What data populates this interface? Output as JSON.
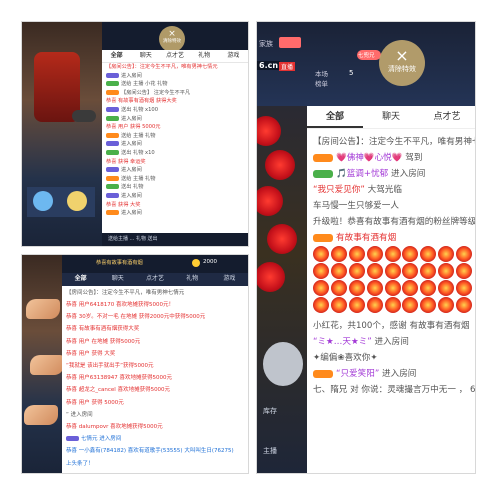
{
  "top_left": {
    "close_label": "清除特效",
    "tabs": [
      "全部",
      "聊天",
      "点才艺",
      "礼物",
      "游戏"
    ],
    "announcement": "【房间公告】：注定今生不平凡，唯有男神七情元",
    "lines": [
      {
        "name": "",
        "text": "进入房间",
        "tag": ""
      },
      {
        "name": "",
        "text": "送给 主播 小花 礼物",
        "tag": ""
      },
      {
        "name": "",
        "text": "【房间公告】 注定今生不平凡",
        "tag": ""
      },
      {
        "name": "",
        "text": "恭喜 有故事有酒有烟 获得大奖",
        "tag": ""
      },
      {
        "name": "",
        "text": "送出 礼物 x100",
        "tag": ""
      },
      {
        "name": "",
        "text": "进入房间",
        "tag": ""
      },
      {
        "name": "",
        "text": "恭喜 用户 获得 5000元",
        "tag": ""
      },
      {
        "name": "",
        "text": "送给 主播 礼物",
        "tag": ""
      },
      {
        "name": "",
        "text": "进入房间",
        "tag": ""
      },
      {
        "name": "",
        "text": "送出 礼物 x10",
        "tag": ""
      },
      {
        "name": "",
        "text": "恭喜 获得 幸运奖",
        "tag": ""
      },
      {
        "name": "",
        "text": "进入房间",
        "tag": ""
      },
      {
        "name": "",
        "text": "送给 主播 礼物",
        "tag": ""
      },
      {
        "name": "",
        "text": "送出 礼物",
        "tag": ""
      },
      {
        "name": "",
        "text": "进入房间",
        "tag": ""
      },
      {
        "name": "",
        "text": "恭喜 获得 大奖",
        "tag": ""
      },
      {
        "name": "",
        "text": "进入房间",
        "tag": ""
      }
    ],
    "bottom_bar": "送给主播 ... 礼物 送出"
  },
  "bottom_left": {
    "tabs": [
      "全部",
      "聊天",
      "点才艺",
      "礼物",
      "游戏"
    ],
    "gift_count": "2000",
    "header_text": "恭喜有故事有酒有烟",
    "announcement": "【房间公告】：注定今生不平凡，唯有男神七情元",
    "lines": [
      {
        "text": "恭喜 用户6418170 喜欢地摊获得5000元！"
      },
      {
        "text": "恭喜 30岁。不对一毛 在地摊 获得2000元中获得5000元"
      },
      {
        "text": "恭喜 有故事有酒有烟获得大奖"
      },
      {
        "text": "恭喜 用户 在地摊 获得5000元"
      },
      {
        "text": "恭喜 用户 获得 大奖"
      },
      {
        "text": "“我就是 该出手就出手”获得5000元"
      },
      {
        "text": "恭喜 用户63138947 喜欢地摊获得5000元"
      },
      {
        "text": "恭喜 超龙之_cancel 喜欢地摊获得5000元"
      },
      {
        "text": "恭喜 用户 获得 5000元"
      },
      {
        "text": "“ 进入房间"
      },
      {
        "text": "恭喜 dalumpovr 喜欢地摊获得5000元"
      },
      {
        "text": "七情元 进入房间"
      },
      {
        "text": "恭喜 一小鑫有(784182) 喜欢有道歌手(53555) 大叫叫生日(76275)"
      },
      {
        "text": "上头条了！"
      }
    ]
  },
  "right": {
    "header": {
      "title": "家族",
      "room_label": "本场",
      "rank_label": "榜单",
      "domain": "6.cn",
      "live": "直播",
      "rank_no": "5"
    },
    "close_label": "清除特效",
    "tabs": [
      "全部",
      "聊天",
      "点才艺"
    ],
    "announcement": "【房间公告】：注定今生不平凡，唯有男神七",
    "lines": [
      {
        "badge": "o",
        "name": "💗佛神💗心悦💗",
        "text": "驾到",
        "hl": false
      },
      {
        "badge": "g",
        "name": "🎵篮调+忧郁",
        "text": "进入房间",
        "hl": false
      },
      {
        "badge": "",
        "name": "“我只爱见你”",
        "text": "大驾光临",
        "hl": true
      },
      {
        "badge": "",
        "name": "",
        "text": "车马慢一生只够爱一人",
        "hl": false
      },
      {
        "badge": "",
        "name": "",
        "text": "升级啦！恭喜有故事有酒有烟的粉丝牌等级升",
        "hl": false
      },
      {
        "badge": "o",
        "name": "",
        "text": "有故事有酒有烟",
        "hl": true
      }
    ],
    "gift_rows": 4,
    "after_gift": [
      {
        "badge": "",
        "name": "",
        "text": "小红花，共100个，感谢 有故事有酒有烟",
        "hl": true
      },
      {
        "badge": "",
        "name": "“ミ★…天★ミ”",
        "text": "进入房间",
        "hl": false
      },
      {
        "badge": "",
        "name": "",
        "text": "✦编偏❀喜欢你✦",
        "hl": false
      },
      {
        "badge": "o",
        "name": "“只爱笑阳”",
        "text": "进入房间",
        "hl": false
      },
      {
        "badge": "",
        "name": "",
        "text": "七、隋兄 对 你说：灵魂撮言万中无一 ， 6626",
        "hl": false
      }
    ],
    "bottom_labels": [
      "库存",
      "主播"
    ],
    "nick_label": "七兜兄"
  },
  "colors": {
    "accent": "#e43131",
    "name": "#1d6fd6",
    "stage_dark": "#141c2e",
    "badge": "#6a5fd8"
  }
}
